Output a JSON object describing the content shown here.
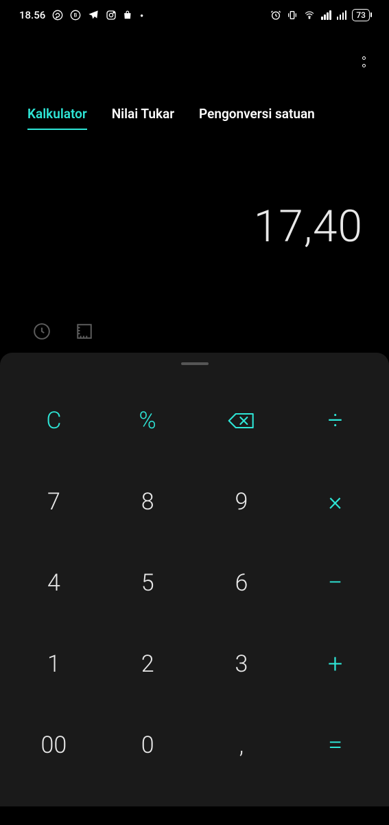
{
  "status": {
    "time": "18.56",
    "battery": "73"
  },
  "tabs": {
    "calculator": "Kalkulator",
    "exchange": "Nilai Tukar",
    "unit": "Pengonversi satuan"
  },
  "display": {
    "value": "17,40"
  },
  "keys": {
    "clear": "C",
    "percent": "%",
    "divide": "÷",
    "7": "7",
    "8": "8",
    "9": "9",
    "multiply": "×",
    "4": "4",
    "5": "5",
    "6": "6",
    "minus": "−",
    "1": "1",
    "2": "2",
    "3": "3",
    "plus": "+",
    "00": "00",
    "0": "0",
    "decimal": ",",
    "equals": "="
  }
}
